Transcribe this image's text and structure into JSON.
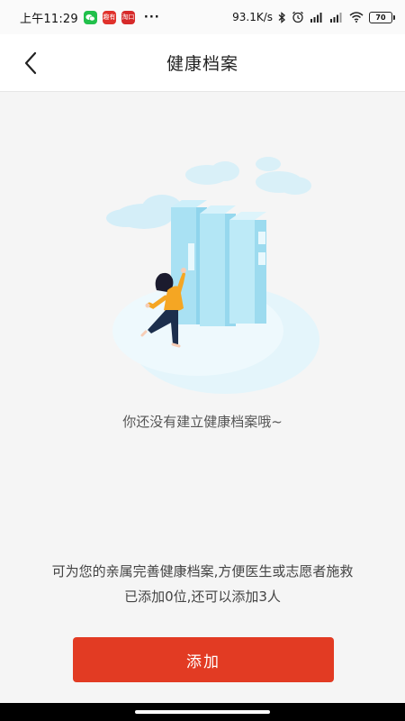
{
  "status_bar": {
    "time": "上午11:29",
    "apps": [
      "wechat-icon",
      "app-red-icon",
      "app-red-2-icon"
    ],
    "app2_text": "趣有",
    "app3_text": "淘口",
    "more": "···",
    "network_speed": "93.1K/s",
    "battery": "70"
  },
  "header": {
    "title": "健康档案"
  },
  "main": {
    "empty_text": "你还没有建立健康档案哦~",
    "info_line1": "可为您的亲属完善健康档案,方便医生或志愿者施救",
    "info_line2": "已添加0位,还可以添加3人",
    "add_label": "添加"
  },
  "colors": {
    "accent": "#e23b23",
    "illustration_light": "#dff3fb",
    "illustration_mid": "#b8e6f6",
    "person_shirt": "#f5a623",
    "person_pants": "#1c2f4d"
  }
}
